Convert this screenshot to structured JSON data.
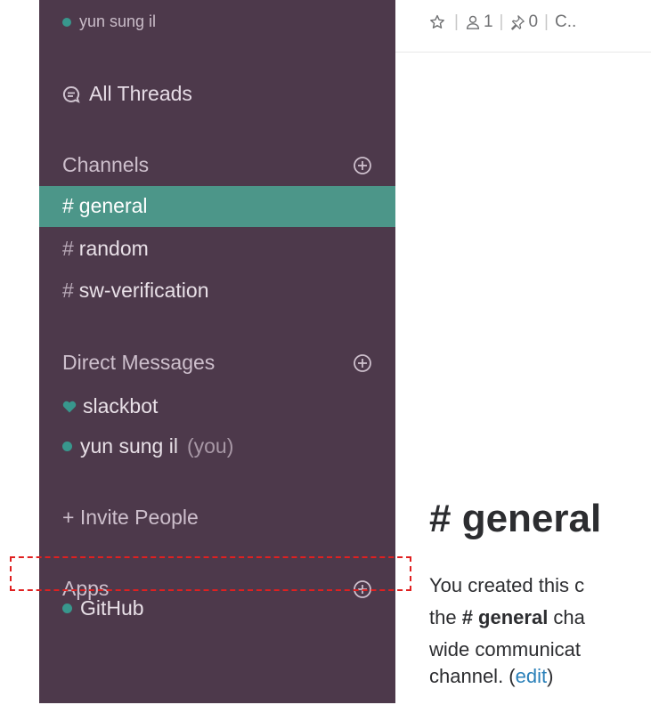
{
  "sidebar": {
    "current_user": "yun sung il",
    "all_threads_label": "All Threads",
    "channels_header": "Channels",
    "channels": [
      {
        "name": "general",
        "active": true
      },
      {
        "name": "random",
        "active": false
      },
      {
        "name": "sw-verification",
        "active": false
      }
    ],
    "dm_header": "Direct Messages",
    "direct_messages": [
      {
        "name": "slackbot",
        "suffix": ""
      },
      {
        "name": "yun sung il",
        "suffix": "(you)"
      }
    ],
    "invite_label": "+ Invite People",
    "apps_header": "Apps",
    "apps": [
      {
        "name": "GitHub"
      }
    ]
  },
  "header": {
    "members_count": "1",
    "pins_count": "0",
    "topic_truncated": "C.."
  },
  "main": {
    "channel_title": "# general",
    "intro_line1": "You created this c",
    "intro_line2_pre": "the ",
    "intro_line2_channel": "# general",
    "intro_line2_post": " cha",
    "intro_line3": "wide communicat",
    "intro_line4_pre": "channel. (",
    "intro_line4_link": "edit",
    "intro_line4_post": ")"
  },
  "colors": {
    "sidebar_bg": "#4d394b",
    "active_channel_bg": "#4c9689",
    "presence_dot": "#38978d",
    "annotation_border": "#e02020"
  }
}
